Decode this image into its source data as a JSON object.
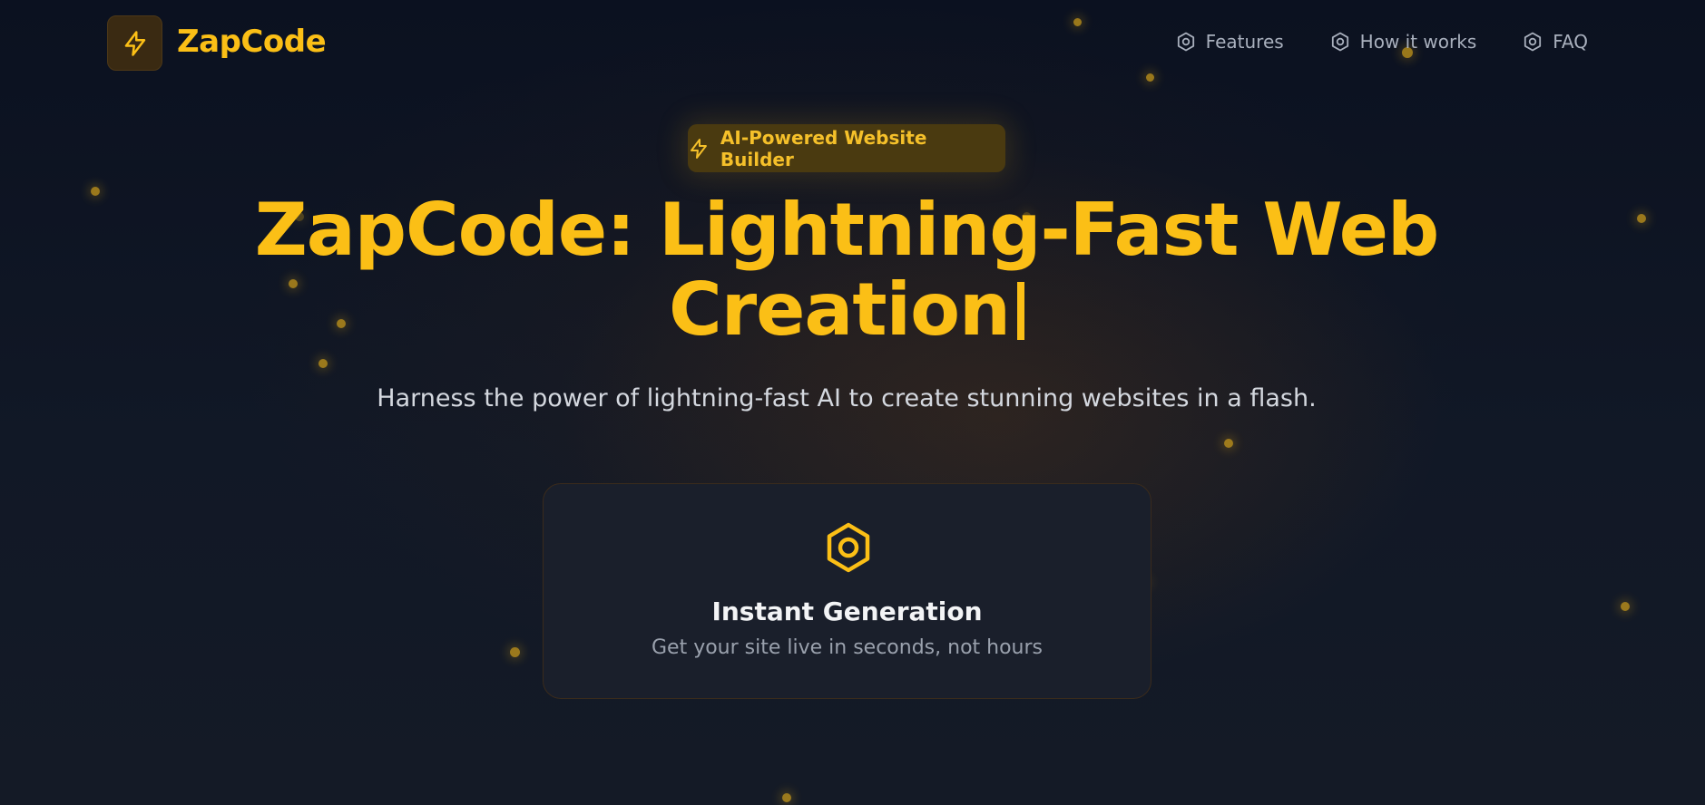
{
  "brand": {
    "name": "ZapCode",
    "logo_icon": "lightning-bolt-icon",
    "accent_color": "#fbbf16"
  },
  "nav": {
    "items": [
      {
        "label": "Features",
        "icon": "hexagon-nut-icon"
      },
      {
        "label": "How it works",
        "icon": "hexagon-nut-icon"
      },
      {
        "label": "FAQ",
        "icon": "hexagon-nut-icon"
      }
    ]
  },
  "badge": {
    "icon": "lightning-bolt-icon",
    "label": "AI-Powered Website Builder"
  },
  "hero": {
    "title_line1": "ZapCode: Lightning-Fast Web",
    "title_line2": "Creation",
    "subtitle": "Harness the power of lightning-fast AI to create stunning websites in a flash."
  },
  "feature_card": {
    "icon": "hexagon-nut-icon",
    "title": "Instant Generation",
    "description": "Get your site live in seconds, not hours"
  }
}
